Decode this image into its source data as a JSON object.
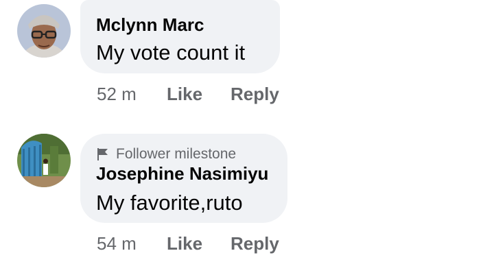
{
  "comments": [
    {
      "author": "Mclynn Marc",
      "text": "My vote count it",
      "badge": "",
      "time": "52 m",
      "like_label": "Like",
      "reply_label": "Reply",
      "avatar_icon": "man-with-glasses-avatar"
    },
    {
      "author": "Josephine Nasimiyu",
      "text": "My favorite,ruto",
      "badge": "Follower milestone",
      "badge_icon": "flag-icon",
      "time": "54 m",
      "like_label": "Like",
      "reply_label": "Reply",
      "avatar_icon": "outdoor-gate-photo-avatar"
    }
  ],
  "colors": {
    "bubble_bg": "#f0f2f5",
    "primary_text": "#050505",
    "secondary_text": "#65676b"
  }
}
